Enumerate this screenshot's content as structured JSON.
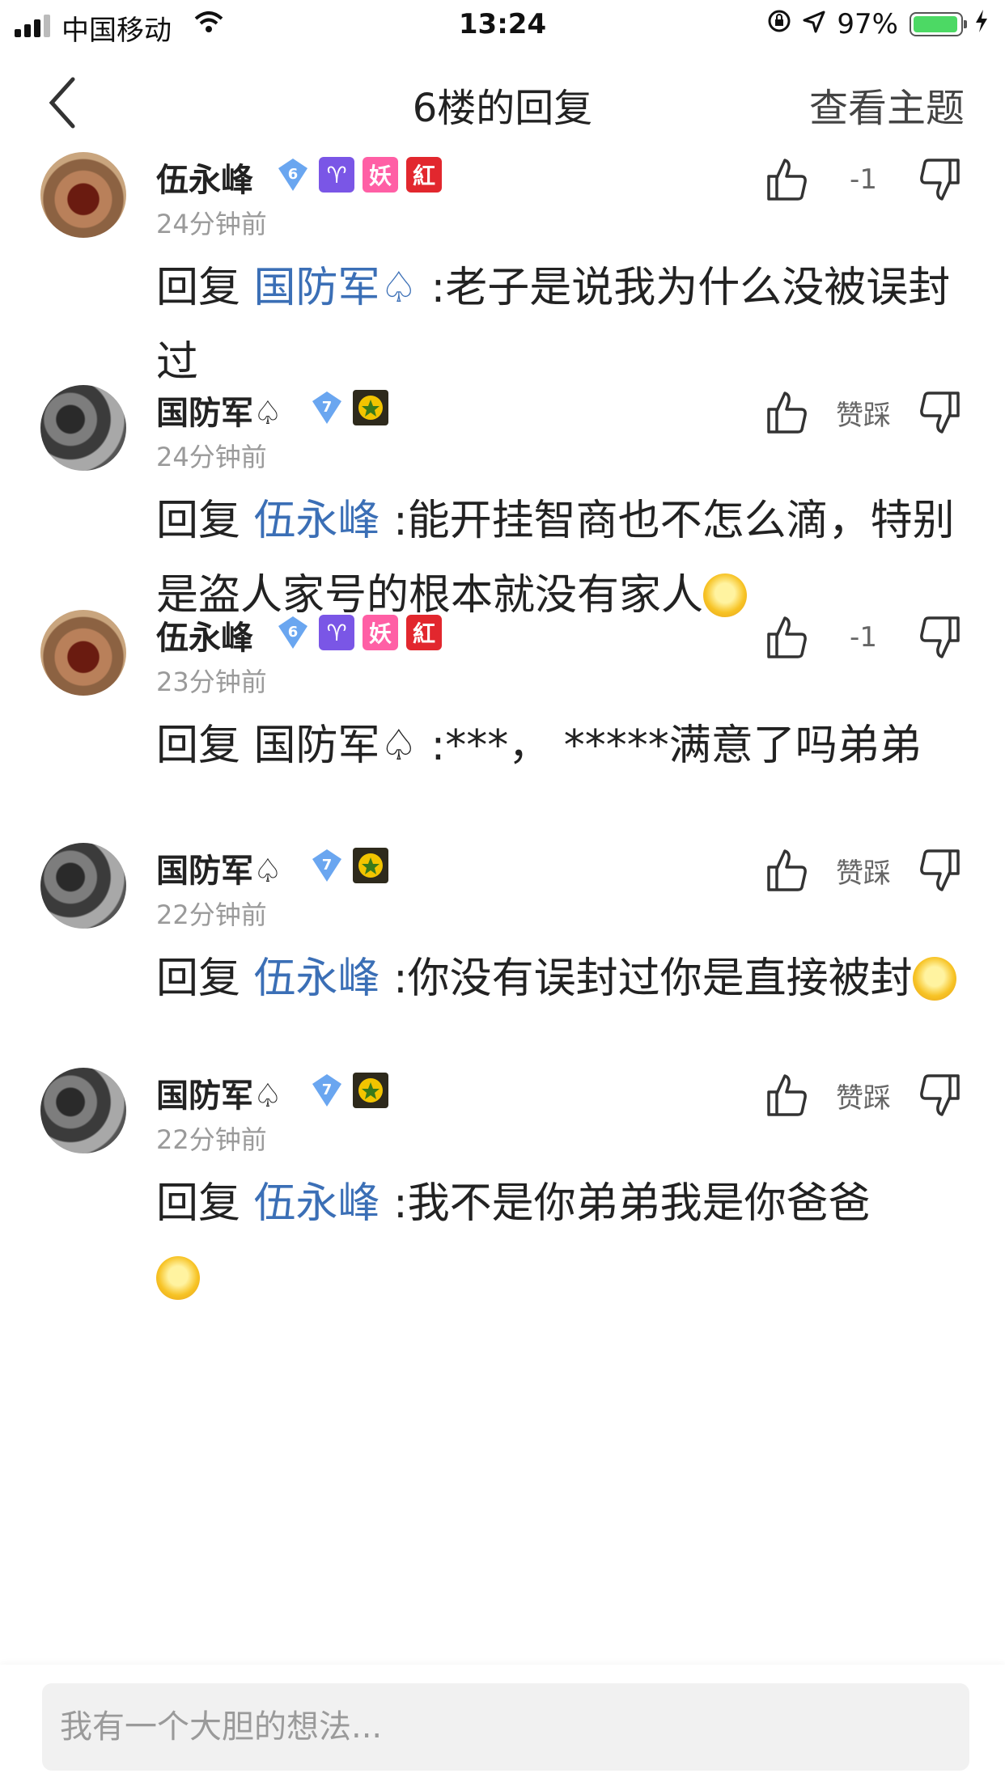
{
  "status_bar": {
    "carrier": "中国移动",
    "time": "13:24",
    "battery_percent": "97%",
    "battery_level": 0.97
  },
  "nav": {
    "title": "6楼的回复",
    "view_topic": "查看主题"
  },
  "replies": [
    {
      "user": "伍永峰",
      "level": "6",
      "badges": [
        "♈",
        "妖",
        "紅"
      ],
      "time": "24分钟前",
      "score": "-1",
      "prefix": "回复 ",
      "mention": "国防军♤",
      "text": " :老子是说我为什么没被误封过",
      "emoji": ""
    },
    {
      "user": "国防军♤",
      "level": "7",
      "badges": [
        "medal"
      ],
      "time": "24分钟前",
      "score": "赞踩",
      "prefix": "回复 ",
      "mention": "伍永峰",
      "text": " :能开挂智商也不怎么滴，特别是盗人家号的根本就没有家人",
      "emoji": "smirk-emoji"
    },
    {
      "user": "伍永峰",
      "level": "6",
      "badges": [
        "♈",
        "妖",
        "紅"
      ],
      "time": "23分钟前",
      "score": "-1",
      "prefix": "回复 ",
      "mention": "国防军♤",
      "text": " :***， *****满意了吗弟弟",
      "emoji": ""
    },
    {
      "user": "国防军♤",
      "level": "7",
      "badges": [
        "medal"
      ],
      "time": "22分钟前",
      "score": "赞踩",
      "prefix": "回复 ",
      "mention": "伍永峰",
      "text": " :你没有误封过你是直接被封",
      "emoji": "smirk-emoji"
    },
    {
      "user": "国防军♤",
      "level": "7",
      "badges": [
        "medal"
      ],
      "time": "22分钟前",
      "score": "赞踩",
      "prefix": "回复 ",
      "mention": "伍永峰",
      "text": " :我不是你弟弟我是你爸爸",
      "emoji": "smirk-emoji"
    }
  ],
  "input": {
    "placeholder": "我有一个大胆的想法..."
  },
  "colors": {
    "link": "#3b6fb6",
    "battery": "#4cd964"
  }
}
